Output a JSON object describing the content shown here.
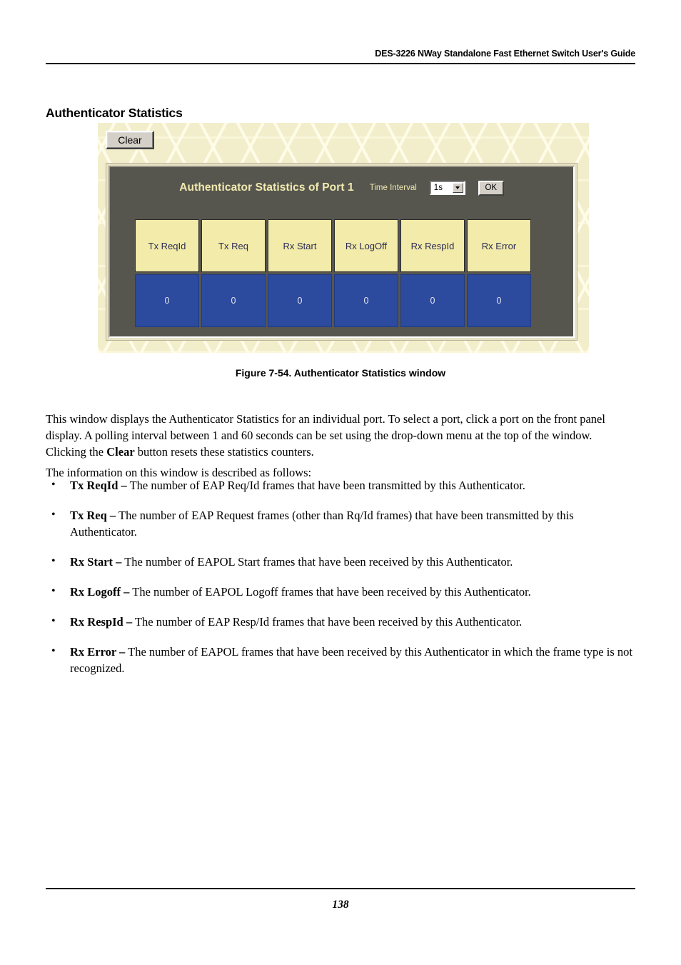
{
  "document": {
    "header_title": "DES-3226 NWay Standalone Fast Ethernet Switch User's Guide",
    "section_title": "Authenticator Statistics",
    "figure_caption": "Figure 7-54.  Authenticator Statistics window",
    "page_number": "138"
  },
  "screenshot": {
    "clear_button": "Clear",
    "panel_title": "Authenticator Statistics of Port 1",
    "time_interval_label": "Time Interval",
    "time_interval_value": "1s",
    "ok_button": "OK",
    "columns": [
      "Tx ReqId",
      "Tx Req",
      "Rx Start",
      "Rx LogOff",
      "Rx RespId",
      "Rx Error"
    ],
    "values": [
      "0",
      "0",
      "0",
      "0",
      "0",
      "0"
    ],
    "colors": {
      "background": "#f2eecb",
      "panel": "#56564f",
      "title_text": "#f2e9ae",
      "header_cell": "#f2eba9",
      "header_cell_text": "#2c2c55",
      "data_cell": "#2c4a9e",
      "data_cell_text": "#e6e6ee",
      "button_face": "#d4d0c8"
    }
  },
  "body": {
    "paragraph_1_part1": "This window displays the Authenticator Statistics for an individual port. To select a port, click a port on the front panel display. A polling interval between 1 and 60 seconds can be set using the drop-down menu at the top of the window. Clicking the ",
    "paragraph_1_bold": "Clear",
    "paragraph_1_part2": " button resets these statistics counters.",
    "paragraph_2": "The information on this window is described as follows:",
    "bullets": [
      {
        "term": "Tx ReqId –",
        "description": " The number of EAP Req/Id frames that have been transmitted by this Authenticator."
      },
      {
        "term": "Tx Req –",
        "description": " The number of EAP Request frames (other than Rq/Id frames) that have been transmitted by this Authenticator."
      },
      {
        "term": "Rx Start –",
        "description": " The number of EAPOL Start frames that have been received by this Authenticator."
      },
      {
        "term": "Rx Logoff –",
        "description": " The number of EAPOL Logoff frames that have been received by this Authenticator."
      },
      {
        "term": "Rx RespId –",
        "description": " The number of EAP Resp/Id frames that have been received by this Authenticator."
      },
      {
        "term": "Rx Error –",
        "description": " The number of EAPOL frames that have been received by this Authenticator in which the frame type is not recognized."
      }
    ]
  }
}
